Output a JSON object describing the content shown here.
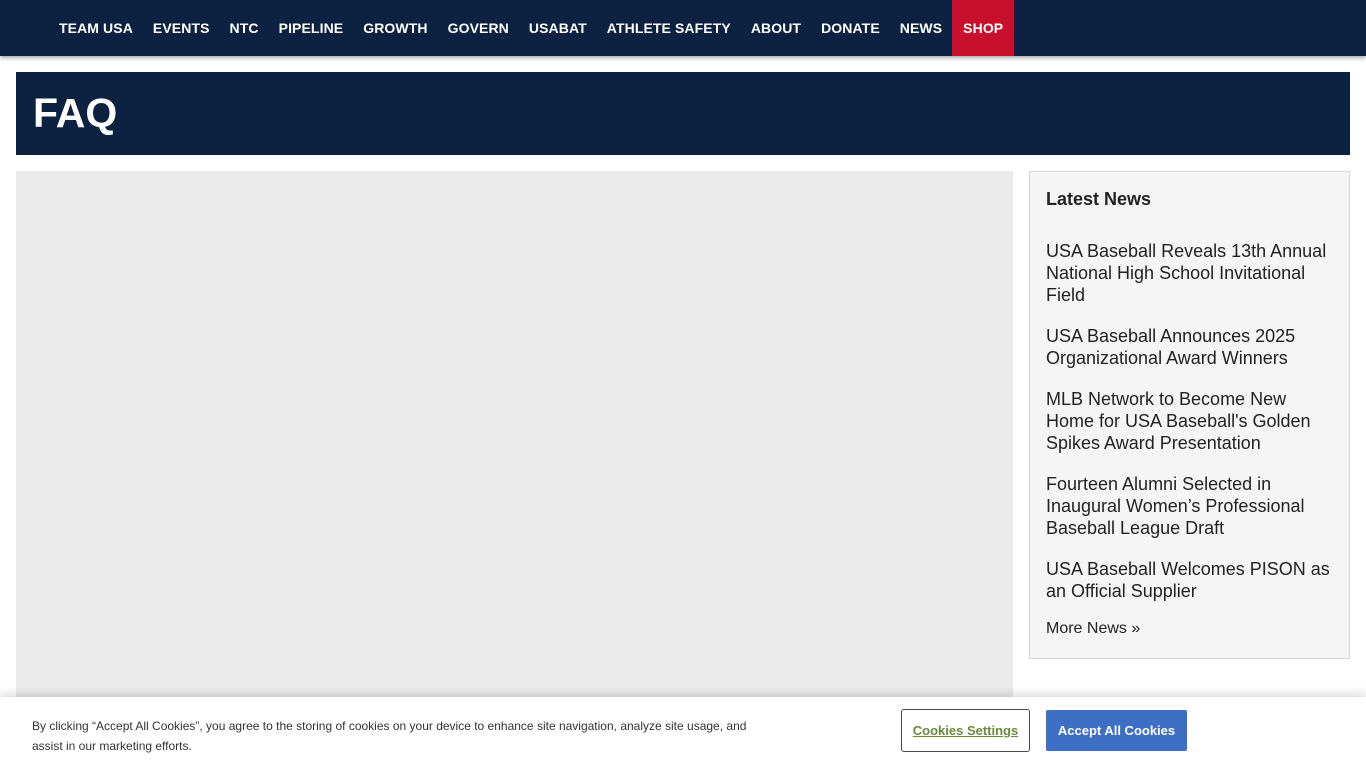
{
  "nav": {
    "items": [
      {
        "label": "TEAM USA"
      },
      {
        "label": "EVENTS"
      },
      {
        "label": "NTC"
      },
      {
        "label": "PIPELINE"
      },
      {
        "label": "GROWTH"
      },
      {
        "label": "GOVERN"
      },
      {
        "label": "USABAT"
      },
      {
        "label": "ATHLETE SAFETY"
      },
      {
        "label": "ABOUT"
      },
      {
        "label": "DONATE"
      },
      {
        "label": "NEWS"
      },
      {
        "label": "SHOP"
      }
    ],
    "shop_color": "#c8102e",
    "bar_color": "#0d2240"
  },
  "page": {
    "title": "FAQ"
  },
  "sidebar": {
    "heading": "Latest News",
    "news": [
      {
        "title": "USA Baseball Reveals 13th Annual National High School Invitational Field"
      },
      {
        "title": "USA Baseball Announces 2025 Organizational Award Winners"
      },
      {
        "title": "MLB Network to Become New Home for USA Baseball's Golden Spikes Award Presentation"
      },
      {
        "title": "Fourteen Alumni Selected in Inaugural Women’s Professional Baseball League Draft"
      },
      {
        "title": "USA Baseball Welcomes PISON as an Official Supplier"
      }
    ],
    "more_link": "More News »"
  },
  "cookie": {
    "text": "By clicking “Accept All Cookies”, you agree to the storing of cookies on your device to enhance site navigation, analyze site usage, and assist in our marketing efforts.",
    "settings_label": "Cookies Settings",
    "accept_label": "Accept All Cookies",
    "accept_color": "#3d6fc5"
  }
}
